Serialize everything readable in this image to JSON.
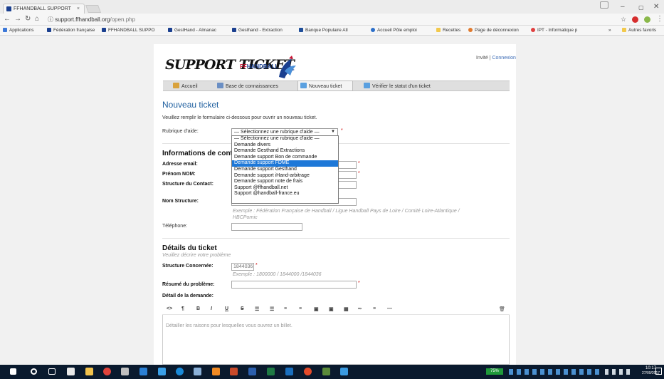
{
  "browser": {
    "tab_title": "FFHANDBALL SUPPORT",
    "tab_close": "×",
    "url_host": "support.ffhandball.org",
    "url_path": "/open.php",
    "bookmarks": [
      "Applications",
      "Fédération française",
      "FFHANDBALL SUPPO",
      "GestHand - Almanac",
      "Gesthand - Extraction",
      "Banque Populaire Atl",
      "Accueil Pôle emploi",
      "Recettes",
      "Page de déconnexion",
      "IPT - Informatique p",
      "»",
      "Autres favoris"
    ]
  },
  "header": {
    "logo_text": "SUPPORT TICKET",
    "brand_ff": "FF",
    "brand_handball": "HANDBALL",
    "guest": "Invité",
    "separator": "|",
    "login": "Connexion"
  },
  "menu": {
    "home": "Accueil",
    "kb": "Base de connaissances",
    "new_ticket": "Nouveau ticket",
    "check_status": "Vérifier le statut d'un ticket"
  },
  "form": {
    "title": "Nouveau ticket",
    "intro": "Veuillez remplir le formulaire ci-dessous pour ouvrir un nouveau ticket.",
    "topic_label": "Rubrique d'aide:",
    "topic_selected": "— Sélectionnez une rubrique d'aide —",
    "topic_options": [
      "— Sélectionnez une rubrique d'aide —",
      "Demande divers",
      "Demande Gesthand Extractions",
      "Demande support Bon de commande",
      "Demande support FDME",
      "Demande support Gesthand",
      "Demande support iHand-arbitrage",
      "Demande support note de frais",
      "Support @ffhandball.net",
      "Support @handball-france.eu"
    ],
    "topic_highlighted_index": 4,
    "contact_section": "Informations de cont",
    "email_label": "Adresse email:",
    "name_label": "Prénom NOM:",
    "structure_contact_label": "Structure du Contact:",
    "nom_structure_label": "Nom Structure:",
    "nom_structure_hint": "Exemple : Fédération Française de Handball / Ligue Handball Pays de Loire / Comité Loire-Atlantique /",
    "nom_structure_hint2": "HBCPornic",
    "phone_label": "Téléphone:",
    "details_section": "Détails du ticket",
    "details_hint": "Veuillez décrire votre problème",
    "structure_concernee_label": "Structure Concernée:",
    "structure_concernee_value": "1844036",
    "structure_concernee_hint": "Exemple : 1800000 / 1844000 /1844036",
    "resume_label": "Résumé du problème:",
    "detail_label": "Détail de la demande:",
    "editor_placeholder": "Détailler les raisons pour lesquelles vous ouvrez un billet.",
    "required_mark": "*"
  },
  "editor_toolbar": [
    "<>",
    "¶",
    "B",
    "I",
    "U",
    "S",
    "☰",
    "☰",
    "≡",
    "≡",
    "▣",
    "▣",
    "▦",
    "∞",
    "≡",
    "—",
    "🗑"
  ],
  "taskbar": {
    "battery": "75%",
    "time": "10:17",
    "date": "27/09/2017"
  }
}
